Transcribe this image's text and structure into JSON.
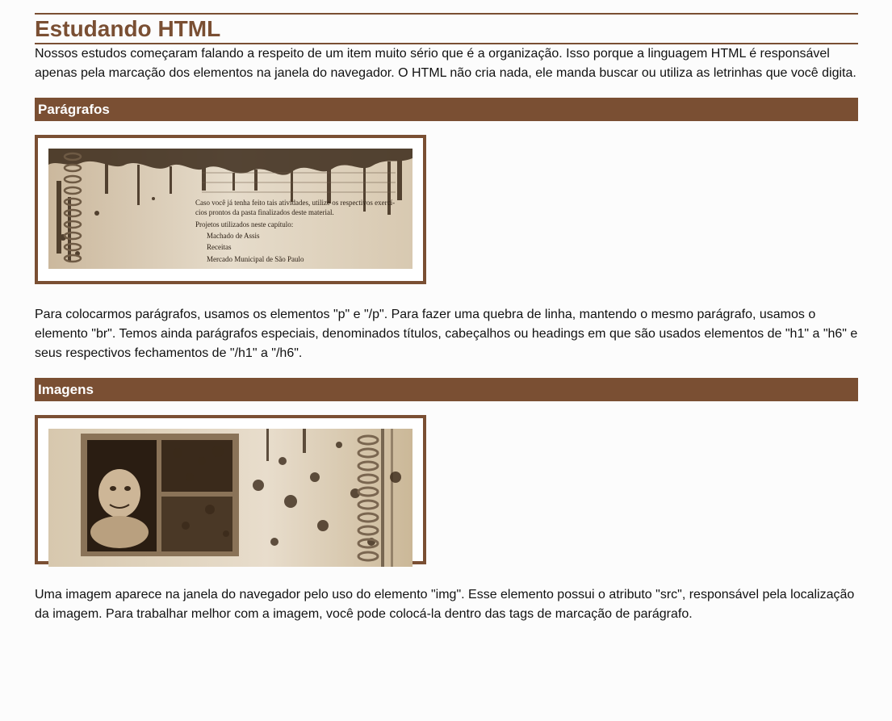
{
  "page": {
    "title": "Estudando HTML",
    "intro": "Nossos estudos começaram falando a respeito de um item muito sério que é a organização. Isso porque a linguagem HTML é responsável apenas pela marcação dos elementos na janela do navegador. O HTML não cria nada, ele manda buscar ou utiliza as letrinhas que você digita."
  },
  "sections": [
    {
      "heading": "Parágrafos",
      "image": {
        "lines": [
          "Caso você já tenha feito tais atividades, utilize os respectivos exercí-",
          "cios prontos da pasta finalizados deste material.",
          "Projetos utilizados neste capítulo:",
          "Machado de Assis",
          "Receitas",
          "Mercado Municipal de São Paulo"
        ]
      },
      "text": "Para colocarmos parágrafos, usamos os elementos \"p\" e \"/p\". Para fazer uma quebra de linha, mantendo o mesmo parágrafo, usamos o elemento \"br\". Temos ainda parágrafos especiais, denominados títulos, cabeçalhos ou headings em que são usados elementos de \"h1\" a \"h6\" e seus respectivos fechamentos de \"/h1\" a \"/h6\"."
    },
    {
      "heading": "Imagens",
      "text": "Uma imagem aparece na janela do navegador pelo uso do elemento \"img\". Esse elemento possui o atributo \"src\", responsável pela localização da imagem. Para trabalhar melhor com a imagem, você pode colocá-la dentro das tags de marcação de parágrafo."
    }
  ],
  "colors": {
    "accent": "#7a4f33",
    "sepia_light": "#e3d6c0",
    "sepia_dark": "#3b2a1a"
  }
}
